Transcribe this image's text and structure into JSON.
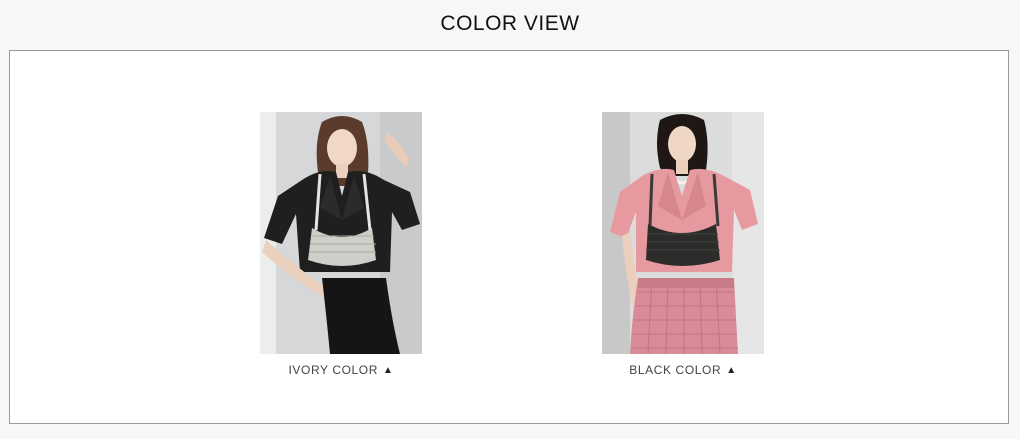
{
  "header": {
    "title": "COLOR VIEW"
  },
  "items": [
    {
      "caption": "IVORY COLOR",
      "arrow_icon": "triangle-up-icon"
    },
    {
      "caption": "BLACK COLOR",
      "arrow_icon": "triangle-up-icon"
    }
  ],
  "colors": {
    "page_background": "#f7f7f7",
    "frame_border": "#9a9a9a",
    "caption_text": "#444444"
  }
}
